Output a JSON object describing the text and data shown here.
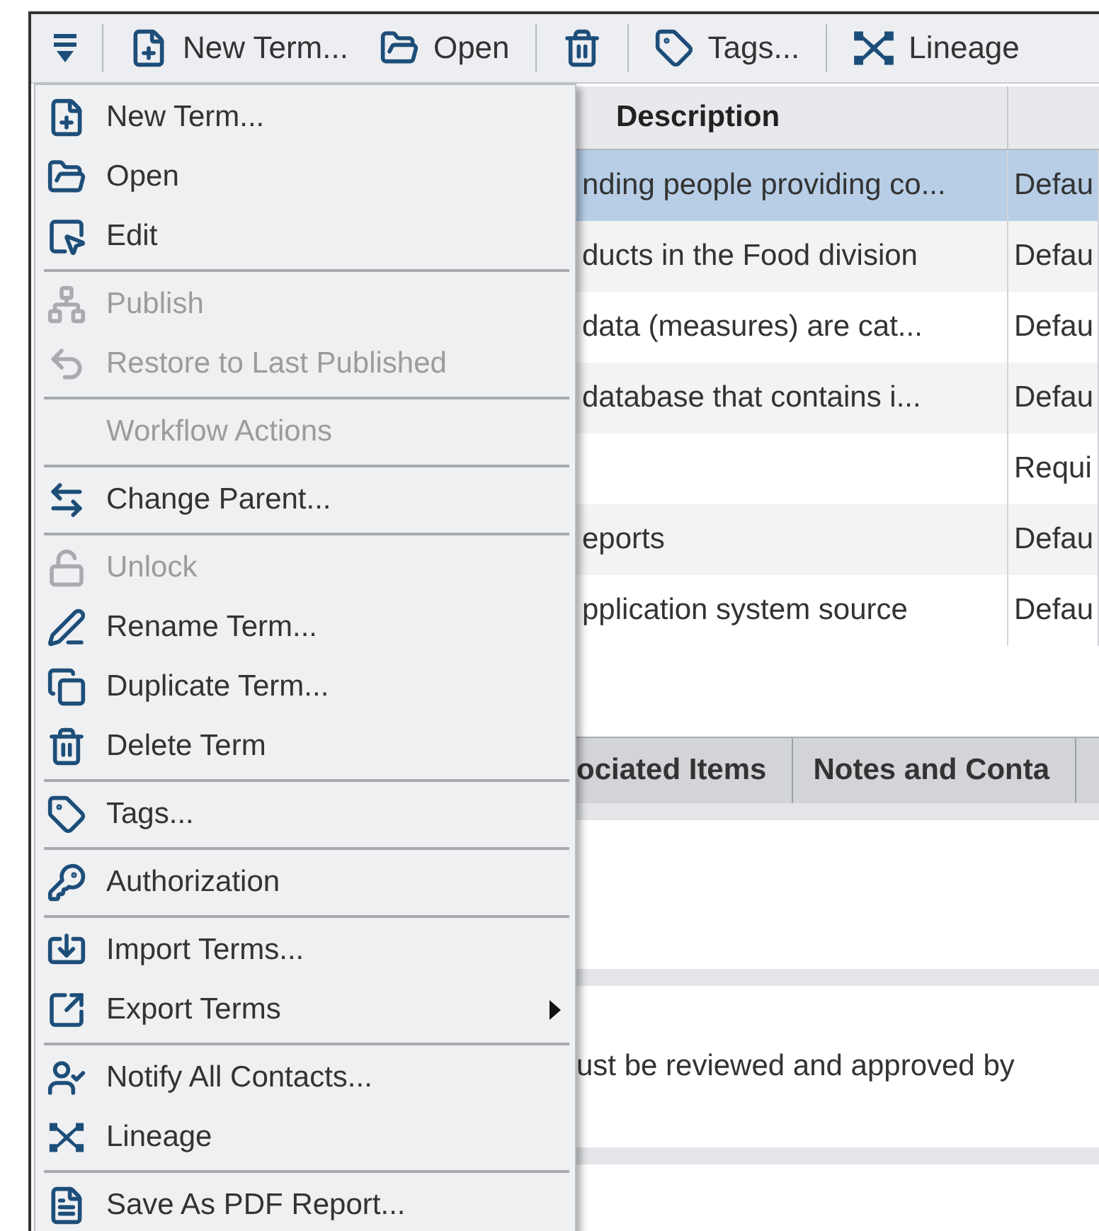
{
  "toolbar": [
    {
      "kind": "menu"
    },
    {
      "kind": "separator"
    },
    {
      "kind": "button",
      "label": "New Term..."
    },
    {
      "kind": "button",
      "label": "Open"
    },
    {
      "kind": "separator"
    },
    {
      "kind": "icon"
    },
    {
      "kind": "separator"
    },
    {
      "kind": "button",
      "label": "Tags..."
    },
    {
      "kind": "separator"
    },
    {
      "kind": "button",
      "label": "Lineage"
    }
  ],
  "context_menu": [
    {
      "kind": "item",
      "label": "New Term...",
      "disabled": false
    },
    {
      "kind": "item",
      "label": "Open",
      "disabled": false
    },
    {
      "kind": "item",
      "label": "Edit",
      "disabled": false
    },
    {
      "kind": "separator"
    },
    {
      "kind": "item",
      "label": "Publish",
      "disabled": true
    },
    {
      "kind": "item",
      "label": "Restore to Last Published",
      "disabled": true
    },
    {
      "kind": "separator"
    },
    {
      "kind": "header",
      "label": "Workflow Actions",
      "disabled": true
    },
    {
      "kind": "separator"
    },
    {
      "kind": "item",
      "label": "Change Parent...",
      "disabled": false
    },
    {
      "kind": "separator"
    },
    {
      "kind": "item",
      "label": "Unlock",
      "disabled": true
    },
    {
      "kind": "item",
      "label": "Rename Term...",
      "disabled": false
    },
    {
      "kind": "item",
      "label": "Duplicate Term...",
      "disabled": false
    },
    {
      "kind": "item",
      "label": "Delete Term",
      "disabled": false
    },
    {
      "kind": "separator"
    },
    {
      "kind": "item",
      "label": "Tags...",
      "disabled": false
    },
    {
      "kind": "separator"
    },
    {
      "kind": "item",
      "label": "Authorization",
      "disabled": false
    },
    {
      "kind": "separator"
    },
    {
      "kind": "item",
      "label": "Import Terms...",
      "disabled": false
    },
    {
      "kind": "item",
      "label": "Export Terms",
      "disabled": false,
      "submenu": true
    },
    {
      "kind": "separator"
    },
    {
      "kind": "item",
      "label": "Notify All Contacts...",
      "disabled": false
    },
    {
      "kind": "item",
      "label": "Lineage",
      "disabled": false
    },
    {
      "kind": "separator"
    },
    {
      "kind": "item",
      "label": "Save As PDF Report...",
      "disabled": false
    }
  ],
  "table": {
    "columns": [
      "Description"
    ],
    "rows": [
      {
        "cells": [
          "nding people providing co...",
          "Defau"
        ],
        "selected": true
      },
      {
        "cells": [
          "ducts in the Food division",
          "Defau"
        ],
        "selected": false
      },
      {
        "cells": [
          "data (measures) are cat...",
          "Defau"
        ],
        "selected": false
      },
      {
        "cells": [
          "database that contains i...",
          "Defau"
        ],
        "selected": false
      },
      {
        "cells": [
          "",
          "Requi"
        ],
        "selected": false
      },
      {
        "cells": [
          "eports",
          "Defau"
        ],
        "selected": false
      },
      {
        "cells": [
          "pplication system source",
          "Defau"
        ],
        "selected": false
      }
    ]
  },
  "detail_tabs": [
    {
      "label": "ociated Items"
    },
    {
      "label": "Notes and Conta"
    }
  ],
  "detail_text": "ust be reviewed and approved by"
}
